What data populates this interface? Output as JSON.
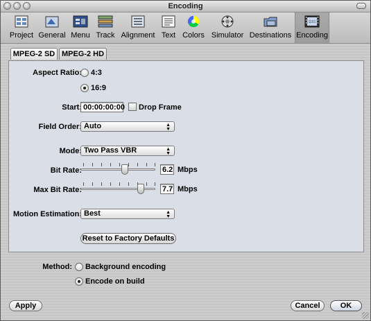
{
  "window": {
    "title": "Encoding"
  },
  "toolbar": {
    "items": [
      {
        "label": "Project",
        "icon": "project-icon"
      },
      {
        "label": "General",
        "icon": "general-icon"
      },
      {
        "label": "Menu",
        "icon": "menu-icon"
      },
      {
        "label": "Track",
        "icon": "track-icon"
      },
      {
        "label": "Alignment",
        "icon": "alignment-icon"
      },
      {
        "label": "Text",
        "icon": "text-icon"
      },
      {
        "label": "Colors",
        "icon": "colors-icon"
      },
      {
        "label": "Simulator",
        "icon": "simulator-icon"
      },
      {
        "label": "Destinations",
        "icon": "destinations-icon"
      },
      {
        "label": "Encoding",
        "icon": "encoding-icon",
        "selected": true
      }
    ]
  },
  "tabs": [
    {
      "label": "MPEG-2 SD",
      "active": true
    },
    {
      "label": "MPEG-2 HD",
      "active": false
    }
  ],
  "sd": {
    "aspect_ratio_label": "Aspect Ratio:",
    "aspect_options": [
      "4:3",
      "16:9"
    ],
    "aspect_selected": "16:9",
    "start_label": "Start:",
    "start_value": "00:00:00:00",
    "drop_frame_label": "Drop Frame",
    "drop_frame_checked": false,
    "field_order_label": "Field Order:",
    "field_order_value": "Auto",
    "mode_label": "Mode:",
    "mode_value": "Two Pass VBR",
    "bit_rate_label": "Bit Rate:",
    "bit_rate_value": "6.2",
    "bit_rate_unit": "Mbps",
    "max_bit_rate_label": "Max Bit Rate:",
    "max_bit_rate_value": "7.7",
    "max_bit_rate_unit": "Mbps",
    "motion_label": "Motion Estimation:",
    "motion_value": "Best",
    "reset_label": "Reset to Factory Defaults"
  },
  "method": {
    "label": "Method:",
    "options": [
      "Background encoding",
      "Encode on build"
    ],
    "selected": "Encode on build"
  },
  "buttons": {
    "apply": "Apply",
    "cancel": "Cancel",
    "ok": "OK"
  },
  "colors": {
    "panel": "#dadee6",
    "selected_tool": "#a3a3a3"
  }
}
